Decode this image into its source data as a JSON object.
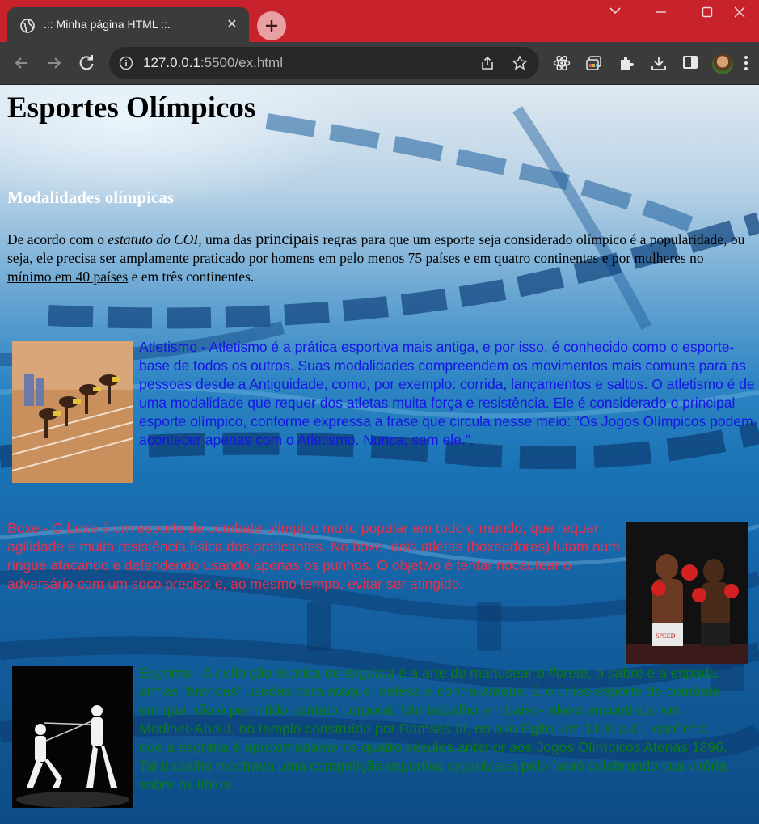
{
  "browser": {
    "tab_title": ".:: Minha página HTML ::.",
    "url_host": "127.0.0.1",
    "url_rest": ":5500/ex.html",
    "colors": {
      "tabbar": "#c8232c",
      "toolbar": "#3b3b3b",
      "omnibox": "#282828"
    }
  },
  "page": {
    "title": "Esportes Olímpicos",
    "subtitle": "Modalidades olímpicas",
    "intro": {
      "t1": "De acordo com o ",
      "em": "estatuto do COI",
      "t2": ", uma das ",
      "big": "principais",
      "t3": " regras para que um esporte seja considerado olímpico é a popularidade, ou seja, ele precisa ser amplamente praticado ",
      "u1": "por homens em pelo menos 75 países",
      "t4": " e em quatro continentes e ",
      "u2": "por mulheres no mínimo em 40 países",
      "t5": " e em três continentes."
    },
    "sports": {
      "atletismo": {
        "text": "Atletismo - Atletismo é a prática esportiva mais antiga, e por isso, é conhecido como o esporte-base de todos os outros. Suas modalidades compreendem os movimentos mais comuns para as pessoas desde a Antiguidade, como, por exemplo: corrida, lançamentos e saltos. O atletismo é de uma modalidade que requer dos atletas muita força e resistência. Ele é considerado o principal esporte olímpico, conforme expressa a frase que circula nesse meio: “Os Jogos Olímpicos podem acontecer apenas com o Atletismo. Nunca, sem ele.”.",
        "color": "#1515e6"
      },
      "boxe": {
        "text": "Boxe - O boxe é um esporte de combate olímpico muito popular em todo o mundo, que requer agilidade e muita resistência física dos praticantes. No boxe, dois atletas (boxeadores) lutam num ringue atacando e defendendo usando apenas os punhos. O objetivo é tentar nocautear o adversário com um soco preciso e, ao mesmo tempo, evitar ser atingido.",
        "color": "#e8304a"
      },
      "esgrima": {
        "t1": "Esgrima - A definição técnica de ",
        "em1": "esgrima",
        "t2": " é a arte de manusear o ",
        "em2": "florete",
        "t3": ", o sabre e a espada, armas “brancas” usadas para ataque, defesa e contra-ataque. É o único esporte de combate em que não é permitido contato corporal. Um trabalho em baixo-relevo encontrado em Medinet-About, no templo construído por Ramsés III, no alto Egito, em 1190 a.C., confirma que a esgrima é aproximadamente quatro séculos anterior aos Jogos Olímpicos Atenas 1896. Tal trabalho mostrava uma competição esportiva organizada pelo faraó celebrando sua vitória sobre os líbios.",
        "color": "#0a7a1a"
      }
    }
  }
}
